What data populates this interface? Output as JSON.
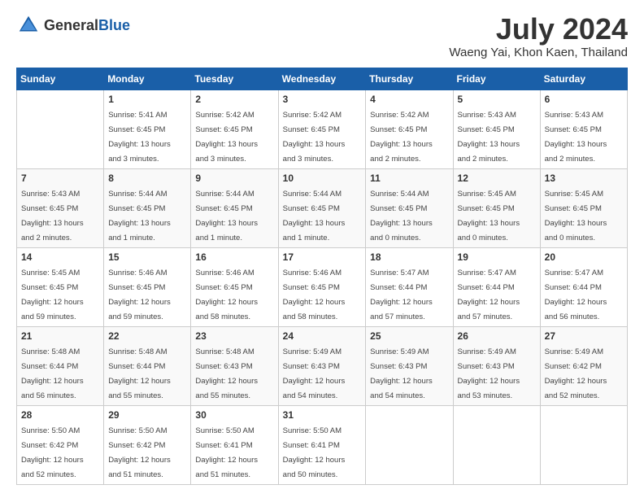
{
  "header": {
    "logo_general": "General",
    "logo_blue": "Blue",
    "month_year": "July 2024",
    "location": "Waeng Yai, Khon Kaen, Thailand"
  },
  "days_of_week": [
    "Sunday",
    "Monday",
    "Tuesday",
    "Wednesday",
    "Thursday",
    "Friday",
    "Saturday"
  ],
  "weeks": [
    [
      {
        "day": "",
        "detail": ""
      },
      {
        "day": "1",
        "detail": "Sunrise: 5:41 AM\nSunset: 6:45 PM\nDaylight: 13 hours\nand 3 minutes."
      },
      {
        "day": "2",
        "detail": "Sunrise: 5:42 AM\nSunset: 6:45 PM\nDaylight: 13 hours\nand 3 minutes."
      },
      {
        "day": "3",
        "detail": "Sunrise: 5:42 AM\nSunset: 6:45 PM\nDaylight: 13 hours\nand 3 minutes."
      },
      {
        "day": "4",
        "detail": "Sunrise: 5:42 AM\nSunset: 6:45 PM\nDaylight: 13 hours\nand 2 minutes."
      },
      {
        "day": "5",
        "detail": "Sunrise: 5:43 AM\nSunset: 6:45 PM\nDaylight: 13 hours\nand 2 minutes."
      },
      {
        "day": "6",
        "detail": "Sunrise: 5:43 AM\nSunset: 6:45 PM\nDaylight: 13 hours\nand 2 minutes."
      }
    ],
    [
      {
        "day": "7",
        "detail": "Sunrise: 5:43 AM\nSunset: 6:45 PM\nDaylight: 13 hours\nand 2 minutes."
      },
      {
        "day": "8",
        "detail": "Sunrise: 5:44 AM\nSunset: 6:45 PM\nDaylight: 13 hours\nand 1 minute."
      },
      {
        "day": "9",
        "detail": "Sunrise: 5:44 AM\nSunset: 6:45 PM\nDaylight: 13 hours\nand 1 minute."
      },
      {
        "day": "10",
        "detail": "Sunrise: 5:44 AM\nSunset: 6:45 PM\nDaylight: 13 hours\nand 1 minute."
      },
      {
        "day": "11",
        "detail": "Sunrise: 5:44 AM\nSunset: 6:45 PM\nDaylight: 13 hours\nand 0 minutes."
      },
      {
        "day": "12",
        "detail": "Sunrise: 5:45 AM\nSunset: 6:45 PM\nDaylight: 13 hours\nand 0 minutes."
      },
      {
        "day": "13",
        "detail": "Sunrise: 5:45 AM\nSunset: 6:45 PM\nDaylight: 13 hours\nand 0 minutes."
      }
    ],
    [
      {
        "day": "14",
        "detail": "Sunrise: 5:45 AM\nSunset: 6:45 PM\nDaylight: 12 hours\nand 59 minutes."
      },
      {
        "day": "15",
        "detail": "Sunrise: 5:46 AM\nSunset: 6:45 PM\nDaylight: 12 hours\nand 59 minutes."
      },
      {
        "day": "16",
        "detail": "Sunrise: 5:46 AM\nSunset: 6:45 PM\nDaylight: 12 hours\nand 58 minutes."
      },
      {
        "day": "17",
        "detail": "Sunrise: 5:46 AM\nSunset: 6:45 PM\nDaylight: 12 hours\nand 58 minutes."
      },
      {
        "day": "18",
        "detail": "Sunrise: 5:47 AM\nSunset: 6:44 PM\nDaylight: 12 hours\nand 57 minutes."
      },
      {
        "day": "19",
        "detail": "Sunrise: 5:47 AM\nSunset: 6:44 PM\nDaylight: 12 hours\nand 57 minutes."
      },
      {
        "day": "20",
        "detail": "Sunrise: 5:47 AM\nSunset: 6:44 PM\nDaylight: 12 hours\nand 56 minutes."
      }
    ],
    [
      {
        "day": "21",
        "detail": "Sunrise: 5:48 AM\nSunset: 6:44 PM\nDaylight: 12 hours\nand 56 minutes."
      },
      {
        "day": "22",
        "detail": "Sunrise: 5:48 AM\nSunset: 6:44 PM\nDaylight: 12 hours\nand 55 minutes."
      },
      {
        "day": "23",
        "detail": "Sunrise: 5:48 AM\nSunset: 6:43 PM\nDaylight: 12 hours\nand 55 minutes."
      },
      {
        "day": "24",
        "detail": "Sunrise: 5:49 AM\nSunset: 6:43 PM\nDaylight: 12 hours\nand 54 minutes."
      },
      {
        "day": "25",
        "detail": "Sunrise: 5:49 AM\nSunset: 6:43 PM\nDaylight: 12 hours\nand 54 minutes."
      },
      {
        "day": "26",
        "detail": "Sunrise: 5:49 AM\nSunset: 6:43 PM\nDaylight: 12 hours\nand 53 minutes."
      },
      {
        "day": "27",
        "detail": "Sunrise: 5:49 AM\nSunset: 6:42 PM\nDaylight: 12 hours\nand 52 minutes."
      }
    ],
    [
      {
        "day": "28",
        "detail": "Sunrise: 5:50 AM\nSunset: 6:42 PM\nDaylight: 12 hours\nand 52 minutes."
      },
      {
        "day": "29",
        "detail": "Sunrise: 5:50 AM\nSunset: 6:42 PM\nDaylight: 12 hours\nand 51 minutes."
      },
      {
        "day": "30",
        "detail": "Sunrise: 5:50 AM\nSunset: 6:41 PM\nDaylight: 12 hours\nand 51 minutes."
      },
      {
        "day": "31",
        "detail": "Sunrise: 5:50 AM\nSunset: 6:41 PM\nDaylight: 12 hours\nand 50 minutes."
      },
      {
        "day": "",
        "detail": ""
      },
      {
        "day": "",
        "detail": ""
      },
      {
        "day": "",
        "detail": ""
      }
    ]
  ]
}
